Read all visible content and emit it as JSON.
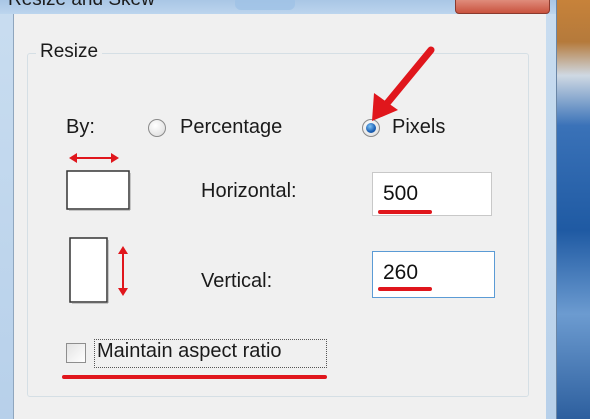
{
  "window": {
    "title": "Resize and Skew"
  },
  "resize": {
    "group_title": "Resize",
    "by_label": "By:",
    "percentage_label": "Percentage",
    "pixels_label": "Pixels",
    "selected": "Pixels",
    "horizontal_label": "Horizontal:",
    "horizontal_value": "500",
    "vertical_label": "Vertical:",
    "vertical_value": "260",
    "maintain_aspect_label": "Maintain aspect ratio",
    "maintain_aspect_checked": false
  },
  "icons": {
    "horizontal": "horizontal-resize-icon",
    "vertical": "vertical-resize-icon",
    "arrow": "red-pointer-arrow"
  },
  "colors": {
    "annotation": "#e0161c",
    "accent": "#1a5fb4"
  }
}
